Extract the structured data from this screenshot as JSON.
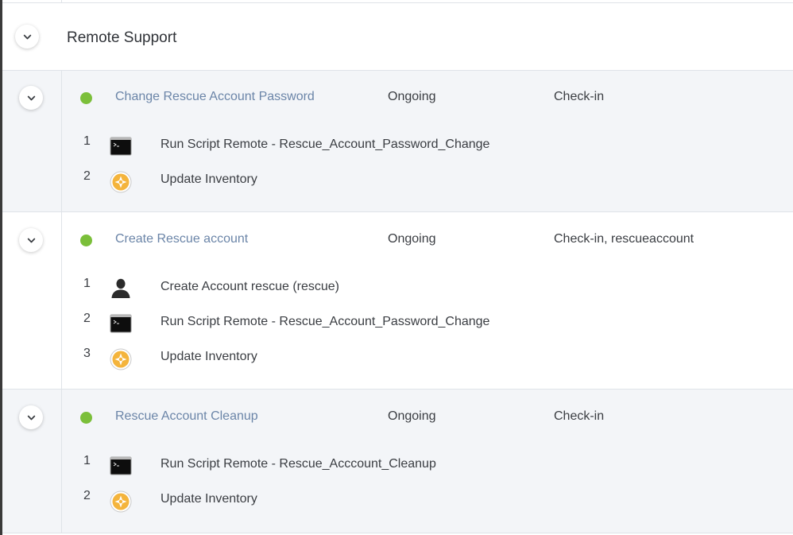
{
  "group": {
    "title": "Remote Support"
  },
  "colors": {
    "status_active": "#7bbf3a",
    "link": "#6b85a8",
    "shaded_row": "#f3f5f8"
  },
  "policies": [
    {
      "name": "Change Rescue Account Password",
      "status": "Ongoing",
      "trigger": "Check-in",
      "steps": [
        {
          "num": "1",
          "icon": "terminal-icon",
          "label": "Run Script Remote - Rescue_Account_Password_Change"
        },
        {
          "num": "2",
          "icon": "inventory-icon",
          "label": "Update Inventory"
        }
      ]
    },
    {
      "name": "Create Rescue account",
      "status": "Ongoing",
      "trigger": "Check-in, rescueaccount",
      "steps": [
        {
          "num": "1",
          "icon": "user-icon",
          "label": "Create Account rescue (rescue)"
        },
        {
          "num": "2",
          "icon": "terminal-icon",
          "label": "Run Script Remote - Rescue_Account_Password_Change"
        },
        {
          "num": "3",
          "icon": "inventory-icon",
          "label": "Update Inventory"
        }
      ]
    },
    {
      "name": "Rescue Account Cleanup",
      "status": "Ongoing",
      "trigger": "Check-in",
      "steps": [
        {
          "num": "1",
          "icon": "terminal-icon",
          "label": "Run Script Remote - Rescue_Acccount_Cleanup"
        },
        {
          "num": "2",
          "icon": "inventory-icon",
          "label": "Update Inventory"
        }
      ]
    }
  ]
}
